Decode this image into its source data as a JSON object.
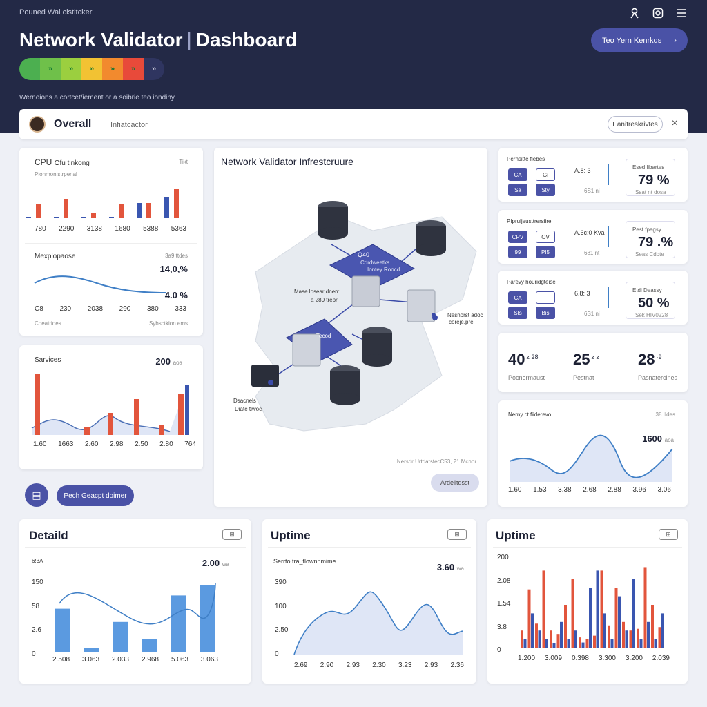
{
  "header": {
    "brand": "Pouned Wal clstitcker",
    "title_main": "Network Validator",
    "title_sep": "|",
    "title_page": "Dashboard",
    "subtitle": "Wernoions a cortcet/iement or a soibrie teo iondiny",
    "action_label": "Teo Yern Kenrkds",
    "action_icon": "chevron-icon",
    "icons": [
      "user-icon",
      "settings-icon",
      "menu-icon"
    ],
    "status_segments": [
      {
        "label": "",
        "color": "#4caf50"
      },
      {
        "label": "»",
        "color": "#6fc04a"
      },
      {
        "label": "»",
        "color": "#9bcf3f"
      },
      {
        "label": "»",
        "color": "#f2c233"
      },
      {
        "label": "»",
        "color": "#f28a2e"
      },
      {
        "label": "»",
        "color": "#e84a3a"
      },
      {
        "label": "»",
        "color": "#2f3560"
      }
    ]
  },
  "overall": {
    "title": "Overall",
    "sub": "Infiatcactor",
    "button": "Eanitreskrivtes",
    "close": "×"
  },
  "cpu_card": {
    "title": "CPU",
    "sub_title": "Ofu tinkong",
    "sub": "Pionmonistrpenal",
    "corner": "Tikt",
    "bars_red": [
      20,
      28,
      8,
      20,
      22,
      42
    ],
    "bars_blue": [
      2,
      2,
      2,
      2,
      22,
      30
    ],
    "axis": [
      "780",
      "2290",
      "3138",
      "1680",
      "5388",
      "5363"
    ],
    "mini_label": "Mexplopaose",
    "mini_corner": "3a9 ttdes",
    "mini_val1": "14,0,%",
    "mini_val2": "4.0 %",
    "mini_axis": [
      "C8",
      "230",
      "2038",
      "290",
      "380",
      "333"
    ],
    "foot_left": "Coeatrioes",
    "foot_right": "Sybsctkion ems"
  },
  "services_card": {
    "title": "Sarvices",
    "value": "200",
    "unit": "aoa",
    "axis": [
      "1.60",
      "1663",
      "2.60",
      "2.98",
      "2.50",
      "2.80",
      "764"
    ]
  },
  "buttons": {
    "round_icon": "clipboard-icon",
    "pill": "Pech Geacpt doimer"
  },
  "infra": {
    "title": "Network Validator Infrestcruure",
    "node_label_1": "Mase losear dnen:",
    "node_label_1b": "a 280 trepr",
    "node_label_2": "Nesnorst adoc",
    "node_label_2b": "coreje.pre",
    "node_label_3": "Dsacnels",
    "node_label_3b": "Diate tiwoc",
    "panel_label": "Q40",
    "panel_sub": "Cdrdweetks",
    "panel_sub2": "Iontey Roocd",
    "panel2_label": "Tecod",
    "footer": "Nersdr UrtdatstecC53, 21 Mcnor",
    "button": "Ardelitdsst"
  },
  "right_panels": [
    {
      "title": "Pernsitte fiebes",
      "tile1": "CA",
      "tile2": "Gi",
      "tile3": "Sa",
      "tile4": "Sty",
      "gauge_label": "A.8: 3",
      "gauge_sub": "6S1 ni",
      "pct_label": "Esed libartes",
      "pct": "79 %",
      "pct_sub": "Ssat nt dosa"
    },
    {
      "title": "Pfpruljeusttrersiire",
      "tile1": "CPV",
      "tile2": "OV",
      "tile3": "99",
      "tile4": "PI5",
      "gauge_label": "A.6c:0 Kva",
      "gauge_sub": "681 nt",
      "pct_label": "Pest fpegsy",
      "pct": "79 .%",
      "pct_sub": "Seas Cdote"
    },
    {
      "title": "Parevy houridgteise",
      "tile1": "CA",
      "tile2": "",
      "tile3": "SIs",
      "tile4": "Bis",
      "gauge_label": "6.8: 3",
      "gauge_sub": "6S1 ni",
      "pct_label": "Etdi Deassy",
      "pct": "50 %",
      "pct_sub": "Sek HIV0228"
    }
  ],
  "stats": [
    {
      "value": "40",
      "sup": "z 28",
      "label": "Pocnermaust"
    },
    {
      "value": "25",
      "sup": "z z",
      "label": "Pestnat"
    },
    {
      "value": "28",
      "sup": "·9",
      "label": "Pasnatercines"
    }
  ],
  "network_card": {
    "title": "Nerny ct fiiderevo",
    "corner": "38 IIdes",
    "value": "1600",
    "unit": "aoa",
    "axis": [
      "1.60",
      "1.53",
      "3.38",
      "2.68",
      "2.88",
      "3.96",
      "3.06"
    ]
  },
  "detail_card": {
    "title": "Detaild",
    "icon": "chart-icon",
    "ylabel": "6!3A",
    "value": "2.00",
    "unit": "wa",
    "yticks": [
      "150",
      "58",
      "2.6",
      "0"
    ],
    "axis": [
      "2.508",
      "3.063",
      "2.033",
      "2.968",
      "5.063",
      "3.063"
    ],
    "bars": [
      0.52,
      0.05,
      0.36,
      0.15,
      0.68,
      0.8
    ]
  },
  "uptime1": {
    "title": "Uptime",
    "icon": "chart-icon",
    "sub": "Serrto tra_flownnmime",
    "value": "3.60",
    "unit": "wa",
    "yticks": [
      "390",
      "100",
      "2.50",
      "0"
    ],
    "axis": [
      "2.69",
      "2.90",
      "2.93",
      "2.30",
      "3.23",
      "2.93",
      "2.36"
    ]
  },
  "uptime2": {
    "title": "Uptime",
    "icon": "chart-icon",
    "yticks": [
      "200",
      "2.08",
      "1.54",
      "3.8",
      "0"
    ],
    "axis": [
      "1.200",
      "3.009",
      "0.398",
      "3.300",
      "3.200",
      "2.039"
    ]
  }
}
